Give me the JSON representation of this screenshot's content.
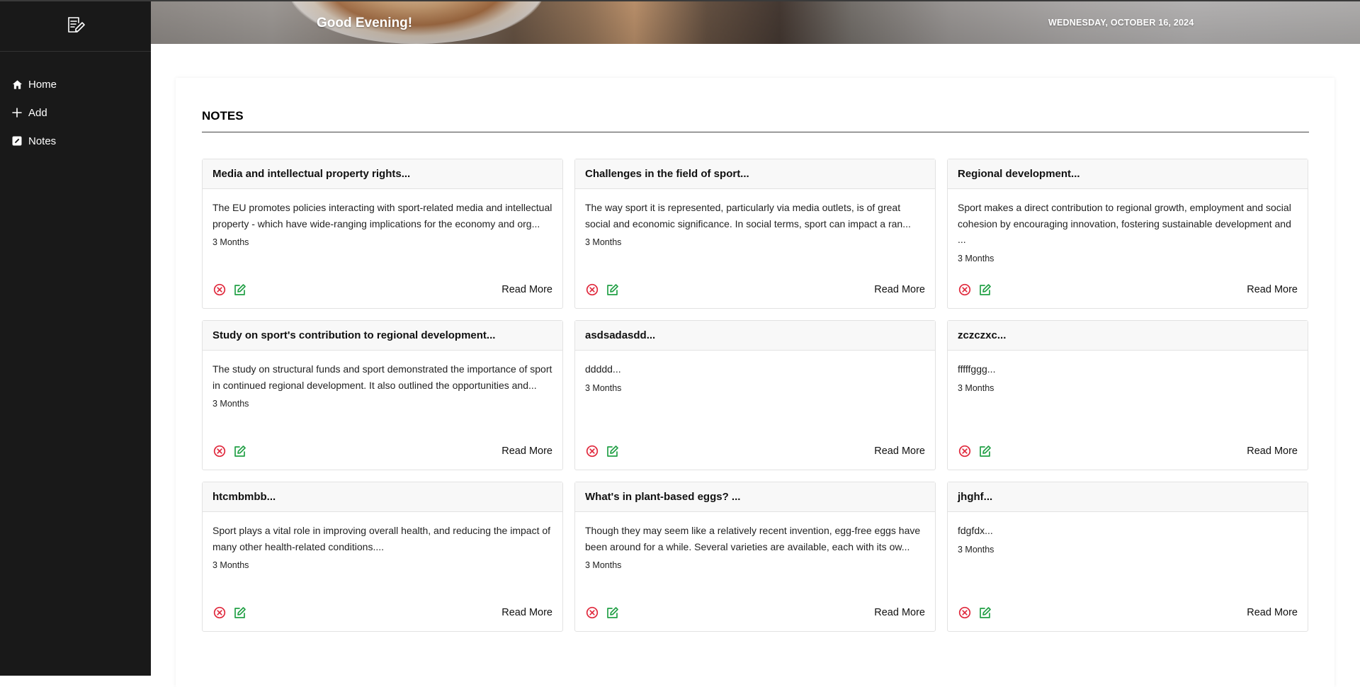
{
  "header": {
    "greeting": "Good Evening!",
    "date": "WEDNESDAY, OCTOBER 16, 2024"
  },
  "sidebar": {
    "logo_icon": "notepad-pencil-icon",
    "items": [
      {
        "label": "Home",
        "icon": "home-icon"
      },
      {
        "label": "Add",
        "icon": "plus-icon"
      },
      {
        "label": "Notes",
        "icon": "note-edit-icon"
      }
    ]
  },
  "notes_section": {
    "title": "NOTES",
    "read_more_label": "Read More",
    "delete_icon": "circle-x-icon",
    "edit_icon": "edit-icon",
    "delete_color": "#e0283c",
    "edit_color": "#22a046"
  },
  "notes": [
    {
      "title": "Media and intellectual property rights...",
      "text": "The EU promotes policies interacting with sport-related media and intellectual property - which have wide-ranging implications for the economy and org...",
      "age": "3 Months"
    },
    {
      "title": "Challenges in the field of sport...",
      "text": "The way sport it is represented, particularly via media outlets, is of great social and economic significance. In social terms, sport can impact a ran...",
      "age": "3 Months"
    },
    {
      "title": "Regional development...",
      "text": "Sport makes a direct contribution to regional growth, employment and social cohesion by encouraging innovation, fostering sustainable development and ...",
      "age": "3 Months"
    },
    {
      "title": "Study on sport's contribution to regional development...",
      "text": "The study on structural funds and sport demonstrated the importance of sport in continued regional development. It also outlined the opportunities and...",
      "age": "3 Months"
    },
    {
      "title": "asdsadasdd...",
      "text": "ddddd...",
      "age": "3 Months"
    },
    {
      "title": "zczczxc...",
      "text": "fffffggg...",
      "age": "3 Months"
    },
    {
      "title": "htcmbmbb...",
      "text": "Sport plays a vital role in improving overall health, and reducing the impact of many other health-related conditions....",
      "age": "3 Months"
    },
    {
      "title": "What's in plant-based eggs? ...",
      "text": "Though they may seem like a relatively recent invention, egg-free eggs have been around for a while. Several varieties are available, each with its ow...",
      "age": "3 Months"
    },
    {
      "title": "jhghf...",
      "text": "fdgfdx...",
      "age": "3 Months"
    }
  ]
}
